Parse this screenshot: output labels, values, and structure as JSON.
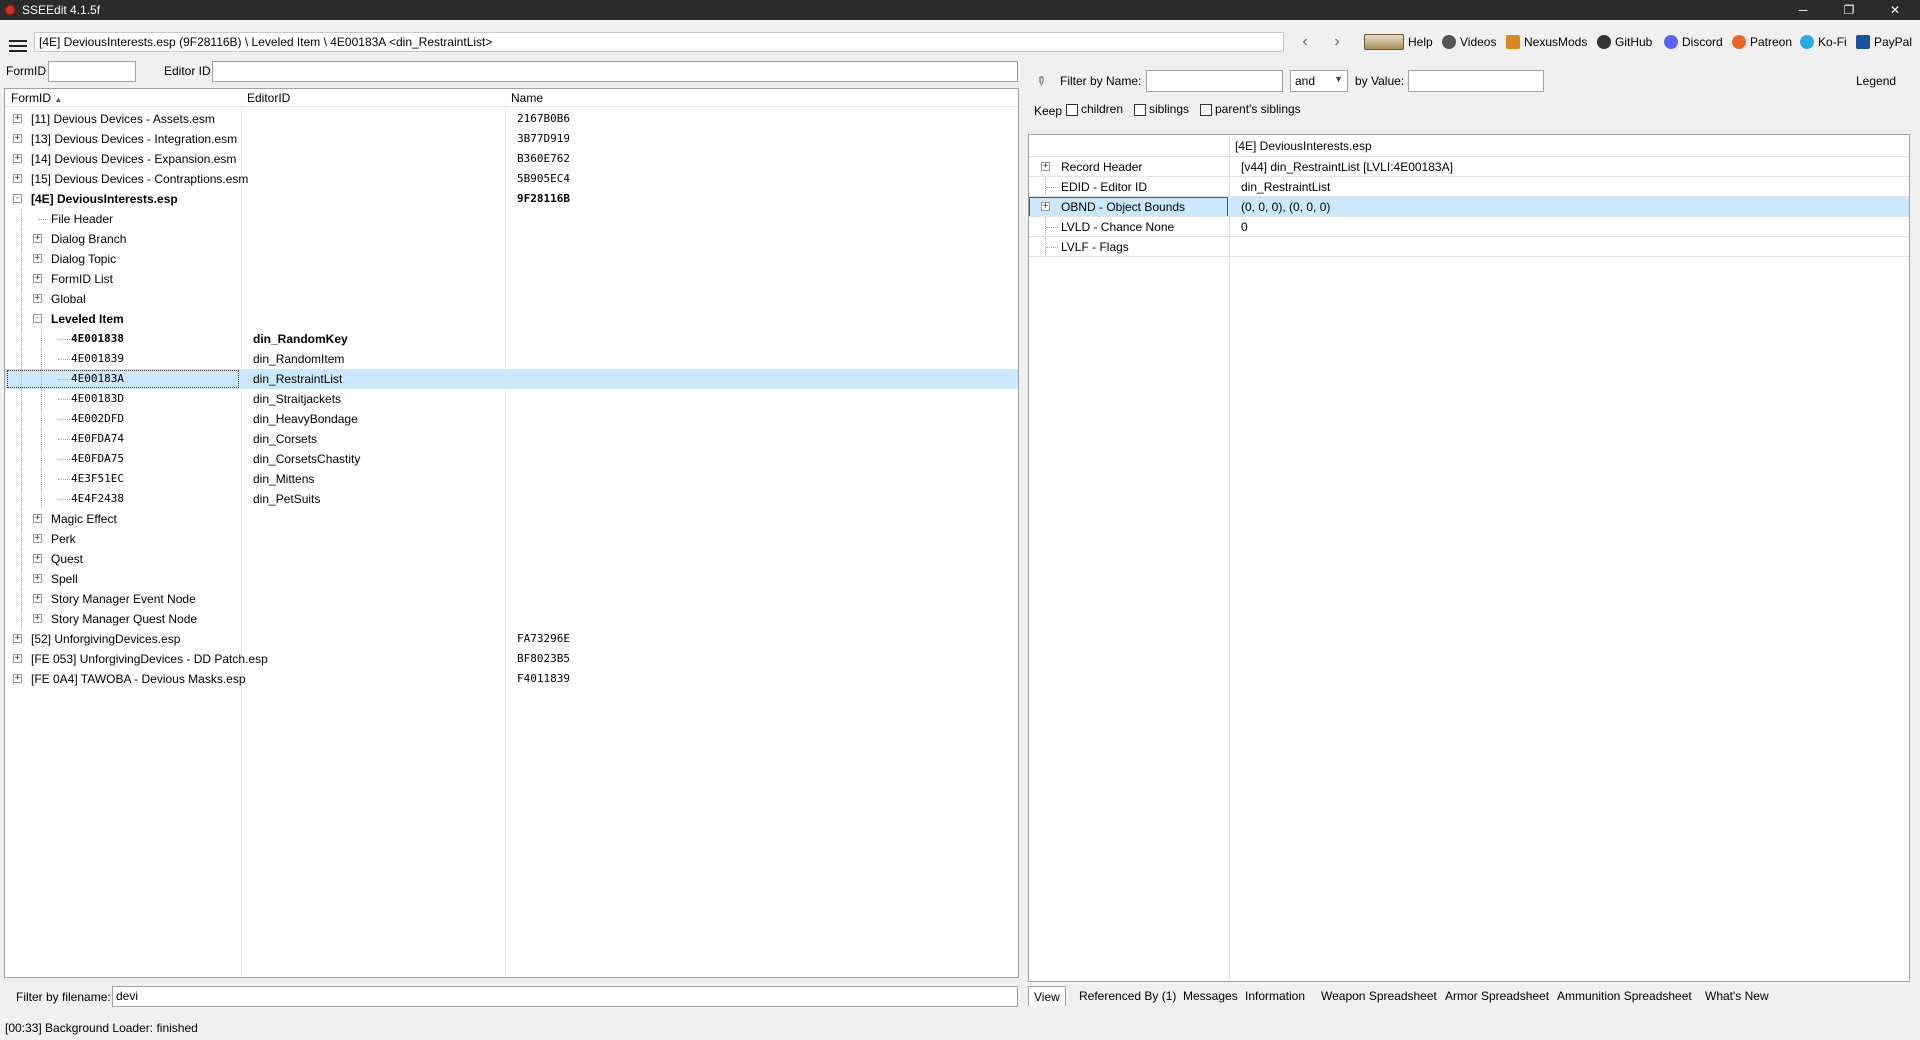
{
  "window": {
    "title": "SSEEdit 4.1.5f"
  },
  "toolbar": {
    "path": "[4E] DeviousInterests.esp (9F28116B) \\ Leveled Item \\ 4E00183A <din_RestraintList>",
    "links": [
      "Help",
      "Videos",
      "NexusMods",
      "GitHub",
      "Discord",
      "Patreon",
      "Ko-Fi",
      "PayPal"
    ]
  },
  "left_filters": {
    "formid_label": "FormID",
    "editorid_label": "Editor ID"
  },
  "tree": {
    "columns": [
      "FormID",
      "EditorID",
      "Name"
    ],
    "sort_indicator": "▲",
    "rows": [
      {
        "formid": "[11] Devious Devices - Assets.esm",
        "editorid": "",
        "name": "2167B0B6"
      },
      {
        "formid": "[13] Devious Devices - Integration.esm",
        "editorid": "",
        "name": "3B77D919"
      },
      {
        "formid": "[14] Devious Devices - Expansion.esm",
        "editorid": "",
        "name": "B360E762"
      },
      {
        "formid": "[15] Devious Devices - Contraptions.esm",
        "editorid": "",
        "name": "5B905EC4"
      },
      {
        "formid": "[4E] DeviousInterests.esp",
        "editorid": "",
        "name": "9F28116B"
      },
      {
        "formid": "File Header",
        "editorid": "",
        "name": ""
      },
      {
        "formid": "Dialog Branch",
        "editorid": "",
        "name": ""
      },
      {
        "formid": "Dialog Topic",
        "editorid": "",
        "name": ""
      },
      {
        "formid": "FormID List",
        "editorid": "",
        "name": ""
      },
      {
        "formid": "Global",
        "editorid": "",
        "name": ""
      },
      {
        "formid": "Leveled Item",
        "editorid": "",
        "name": ""
      },
      {
        "formid": "4E001838",
        "editorid": "din_RandomKey",
        "name": ""
      },
      {
        "formid": "4E001839",
        "editorid": "din_RandomItem",
        "name": ""
      },
      {
        "formid": "4E00183A",
        "editorid": "din_RestraintList",
        "name": ""
      },
      {
        "formid": "4E00183D",
        "editorid": "din_Straitjackets",
        "name": ""
      },
      {
        "formid": "4E002DFD",
        "editorid": "din_HeavyBondage",
        "name": ""
      },
      {
        "formid": "4E0FDA74",
        "editorid": "din_Corsets",
        "name": ""
      },
      {
        "formid": "4E0FDA75",
        "editorid": "din_CorsetsChastity",
        "name": ""
      },
      {
        "formid": "4E3F51EC",
        "editorid": "din_Mittens",
        "name": ""
      },
      {
        "formid": "4E4F2438",
        "editorid": "din_PetSuits",
        "name": ""
      },
      {
        "formid": "Magic Effect",
        "editorid": "",
        "name": ""
      },
      {
        "formid": "Perk",
        "editorid": "",
        "name": ""
      },
      {
        "formid": "Quest",
        "editorid": "",
        "name": ""
      },
      {
        "formid": "Spell",
        "editorid": "",
        "name": ""
      },
      {
        "formid": "Story Manager Event Node",
        "editorid": "",
        "name": ""
      },
      {
        "formid": "Story Manager Quest Node",
        "editorid": "",
        "name": ""
      },
      {
        "formid": "[52] UnforgivingDevices.esp",
        "editorid": "",
        "name": "FA73296E"
      },
      {
        "formid": "[FE 053] UnforgivingDevices - DD Patch.esp",
        "editorid": "",
        "name": "BF8023B5"
      },
      {
        "formid": "[FE 0A4] TAWOBA - Devious Masks.esp",
        "editorid": "",
        "name": "F4011839"
      }
    ]
  },
  "filename_filter": {
    "label": "Filter by filename:",
    "value": "devi"
  },
  "right_filters": {
    "filter_by_name_label": "Filter by Name:",
    "operator_value": "and",
    "by_value_label": "by Value:",
    "legend_label": "Legend",
    "keep_label": "Keep",
    "children_label": "children",
    "siblings_label": "siblings",
    "parents_siblings_label": "parent's siblings"
  },
  "record_view": {
    "column_header": "[4E] DeviousInterests.esp",
    "rows": [
      {
        "name": "Record Header",
        "value": "[v44] din_RestraintList [LVLI:4E00183A]"
      },
      {
        "name": "EDID - Editor ID",
        "value": "din_RestraintList"
      },
      {
        "name": "OBND - Object Bounds",
        "value": "(0, 0, 0), (0, 0, 0)"
      },
      {
        "name": "LVLD - Chance None",
        "value": "0"
      },
      {
        "name": "LVLF - Flags",
        "value": ""
      }
    ]
  },
  "tabs": [
    "View",
    "Referenced By (1)",
    "Messages",
    "Information",
    "Weapon Spreadsheet",
    "Armor Spreadsheet",
    "Ammunition Spreadsheet",
    "What's New"
  ],
  "status": "[00:33] Background Loader: finished"
}
